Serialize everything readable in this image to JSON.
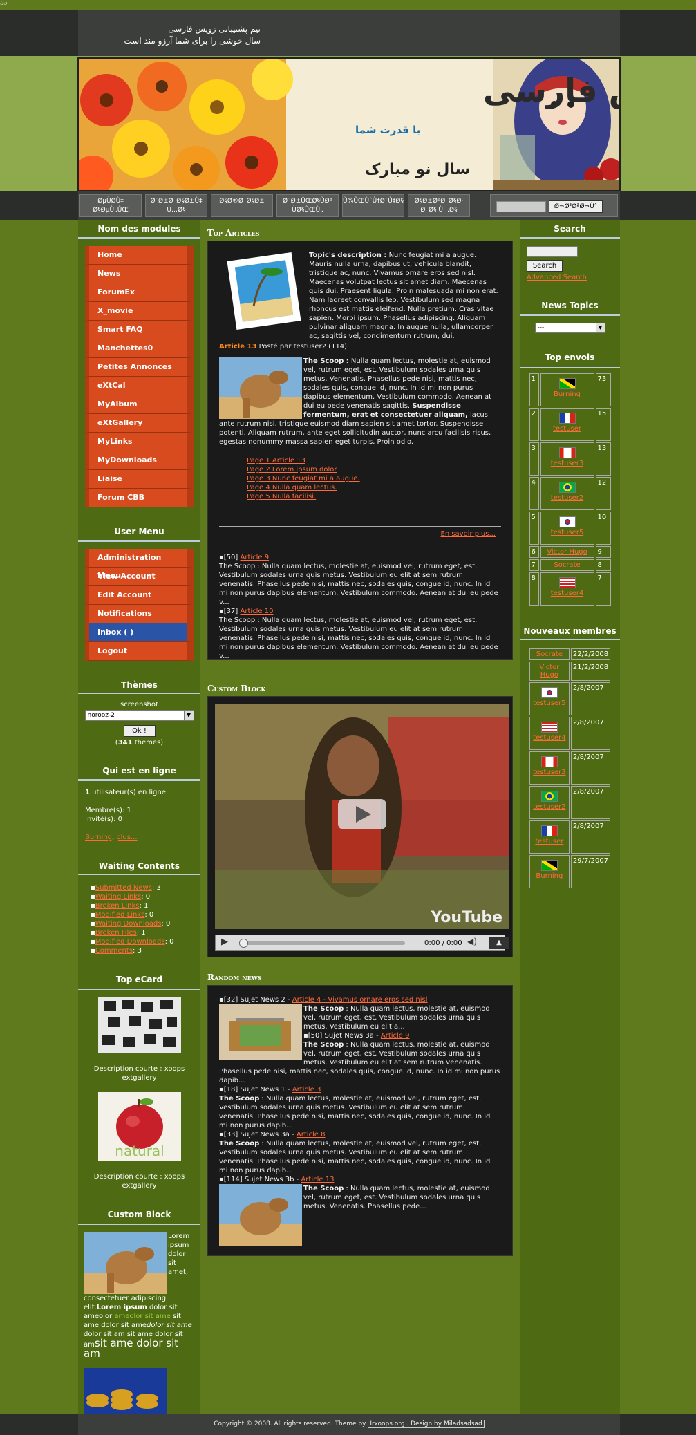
{
  "corner": "ﻯﻥ",
  "slogan": [
    "تیم پشتیبانی زوپس فارسی",
    "سال خوشی را برای شما آرزو مند است"
  ],
  "banner": {
    "title": "زوپس فارسی",
    "subtitle": "با قدرت شما",
    "greeting": "سال نو مبارک"
  },
  "nav": {
    "items": [
      "ØµÙØ­Ù‡ Ø§ØµÙ„ÛŒ",
      "Ø¯Ø±Ø¨Ø§Ø±Ù‡ Ù…Ø§",
      "Ø§Ø®Ø¨Ø§Ø±",
      "Ø¯Ø±ÛŒØ§ÙØª ÙØ§ÛŒÙ„",
      "Ù¾ÛŒÙˆÙ†Ø¯Ù‡Ø§",
      "Ø§Ø±ØªØ¨Ø§Ø· Ø¨Ø§ Ù…Ø§"
    ],
    "search_button": "Ø¬Ø³ØªØ¬Ùˆ"
  },
  "left": {
    "modules_title": "Nom des modules",
    "modules": [
      "Home",
      "News",
      "ForumEx",
      "X_movie",
      "Smart FAQ",
      "Manchettes0",
      "Petites Annonces",
      "eXtCal",
      "MyAlbum",
      "eXtGallery",
      "MyLinks",
      "MyDownloads",
      "Liaise",
      "Forum CBB"
    ],
    "user_title": "User Menu",
    "user_menu": [
      "Administration Menu",
      "View Account",
      "Edit Account",
      "Notifications",
      "Inbox ( )",
      "Logout"
    ],
    "themes_title": "Thèmes",
    "themes_screenshot": "screenshot",
    "themes_selected": "norooz-2",
    "themes_ok": "Ok !",
    "themes_count": "341",
    "themes_suffix": "themes)",
    "online_title": "Qui est en ligne",
    "online_count": "1",
    "online_text": "utilisateur(s) en ligne",
    "members": "Membre(s): 1",
    "guests": "Invité(s): 0",
    "online_user": "Burning",
    "online_more": "plus...",
    "waiting_title": "Waiting Contents",
    "waiting": [
      {
        "label": "Submitted News",
        "count": "3"
      },
      {
        "label": "Waiting Links",
        "count": "0"
      },
      {
        "label": "Broken Links",
        "count": "1"
      },
      {
        "label": "Modified Links",
        "count": "0"
      },
      {
        "label": "Waiting Downloads",
        "count": "0"
      },
      {
        "label": "Broken Files",
        "count": "1"
      },
      {
        "label": "Modified Downloads",
        "count": "0"
      },
      {
        "label": "Comments",
        "count": "3"
      }
    ],
    "ecard_title": "Top eCard",
    "ecard_desc1": "Description courte : xoops extgallery",
    "ecard_natural": "natural",
    "ecard_desc2": "Description courte : xoops extgallery",
    "custom_title": "Custom Block",
    "custom_text1": "Lorem ipsum dolor sit amet, consectetuer adipiscing elit.",
    "custom_bold": "Lorem ipsum",
    "custom_text2": "dolor sit ameolor",
    "custom_green": "ameolor sit ame",
    "custom_text3": "sit ame dolor sit ame",
    "custom_italic": "dolor sit ame",
    "custom_text4": "dolor sit am sit ame dolor sit am",
    "custom_big": "sit ame dolor sit am"
  },
  "center": {
    "top_title": "Top Articles",
    "topic_label": "Topic's description :",
    "topic_text": "Nunc feugiat mi a augue. Mauris nulla urna, dapibus ut, vehicula blandit, tristique ac, nunc. Vivamus ornare eros sed nisl. Maecenas volutpat lectus sit amet diam. Maecenas quis dui. Praesent ligula. Proin malesuada mi non erat. Nam laoreet convallis leo. Vestibulum sed magna rhoncus est mattis eleifend. Nulla pretium. Cras vitae sapien. Morbi ipsum. Phasellus adipiscing. Aliquam pulvinar aliquam magna. In augue nulla, ullamcorper ac, sagittis vel, condimentum rutrum, dui.",
    "article_label": "Article 13",
    "article_posted": "Posté par testuser2 (114)",
    "scoop_label": "The Scoop :",
    "scoop_text": "Nulla quam lectus, molestie at, euismod vel, rutrum eget, est. Vestibulum sodales urna quis metus. Venenatis. Phasellus pede nisi, mattis nec, sodales quis, congue id, nunc. In id mi non purus dapibus elementum. Vestibulum commodo. Aenean at dui eu pede venenatis sagittis.",
    "scoop_bold": "Suspendisse fermentum, erat et consectetuer aliquam,",
    "scoop_text2": "lacus ante rutrum nisi, tristique euismod diam sapien sit amet tortor. Suspendisse potenti. Aliquam rutrum, ante eget sollicitudin auctor, nunc arcu facilisis risus, egestas nonummy massa sapien eget turpis. Proin odio.",
    "pages": [
      "Page 1 Article 13",
      "Page 2 Lorem ipsum dolor",
      "Page 3 Nunc feugiat mi a augue.",
      "Page 4 Nulla quam lectus.",
      "Page 5 Nulla facilisi."
    ],
    "readmore": "En savoir plus...",
    "art9_prefix": "[50]",
    "art9_link": "Article 9",
    "art9_text": "The Scoop : Nulla quam lectus, molestie at, euismod vel, rutrum eget, est. Vestibulum sodales urna quis metus. Vestibulum eu elit at sem rutrum venenatis. Phasellus pede nisi, mattis nec, sodales quis, congue id, nunc. In id mi non purus dapibus elementum. Vestibulum commodo. Aenean at dui eu pede v...",
    "art10_prefix": "[37]",
    "art10_link": "Article 10",
    "art10_text": "The Scoop : Nulla quam lectus, molestie at, euismod vel, rutrum eget, est. Vestibulum sodales urna quis metus. Vestibulum eu elit at sem rutrum venenatis. Phasellus pede nisi, mattis nec, sodales quis, congue id, nunc. In id mi non purus dapibus elementum. Vestibulum commodo. Aenean at dui eu pede v...",
    "custom_title": "Custom Block",
    "video_time": "0:00 / 0:00",
    "video_brand": "YouTube",
    "random_title": "Random news",
    "random": [
      {
        "prefix": "[32] Sujet News 2 -",
        "link": "Article 4 - Vivamus ornare eros sed nisl",
        "text": "Nulla quam lectus, molestie at, euismod vel, rutrum eget, est. Vestibulum sodales urna quis metus. Vestibulum eu elit a..."
      },
      {
        "prefix": "[50] Sujet News 3a -",
        "link": "Article 9",
        "text": "Nulla quam lectus, molestie at, euismod vel, rutrum eget, est. Vestibulum sodales urna quis metus. Vestibulum eu elit at sem rutrum venenatis. Phasellus pede nisi, mattis nec, sodales quis, congue id, nunc. In id mi non purus dapib..."
      },
      {
        "prefix": "[18] Sujet News 1 -",
        "link": "Article 3",
        "text": "Nulla quam lectus, molestie at, euismod vel, rutrum eget, est. Vestibulum sodales urna quis metus. Vestibulum eu elit at sem rutrum venenatis. Phasellus pede nisi, mattis nec, sodales quis, congue id, nunc. In id mi non purus dapib..."
      },
      {
        "prefix": "[33] Sujet News 3a -",
        "link": "Article 8",
        "text": "Nulla quam lectus, molestie at, euismod vel, rutrum eget, est. Vestibulum sodales urna quis metus. Vestibulum eu elit at sem rutrum venenatis. Phasellus pede nisi, mattis nec, sodales quis, congue id, nunc. In id mi non purus dapib..."
      },
      {
        "prefix": "[114] Sujet News 3b -",
        "link": "Article 13",
        "text": "Nulla quam lectus, molestie at, euismod vel, rutrum eget, est. Vestibulum sodales urna quis metus. Venenatis. Phasellus pede..."
      }
    ]
  },
  "right": {
    "search_title": "Search",
    "search_button": "Search",
    "advanced": "Advanced Search",
    "topics_title": "News Topics",
    "topics_selected": "---",
    "top_title": "Top envois",
    "top": [
      {
        "rank": "1",
        "user": "Burning",
        "count": "73",
        "flag": "jamaica"
      },
      {
        "rank": "2",
        "user": "testuser",
        "count": "15",
        "flag": "france"
      },
      {
        "rank": "3",
        "user": "testuser3",
        "count": "13",
        "flag": "canada"
      },
      {
        "rank": "4",
        "user": "testuser2",
        "count": "12",
        "flag": "brazil"
      },
      {
        "rank": "5",
        "user": "testuser5",
        "count": "10",
        "flag": "korea"
      },
      {
        "rank": "6",
        "user": "Victor Hugo",
        "count": "9",
        "flag": ""
      },
      {
        "rank": "7",
        "user": "Socrate",
        "count": "8",
        "flag": ""
      },
      {
        "rank": "8",
        "user": "testuser4",
        "count": "7",
        "flag": "usa"
      }
    ],
    "new_title": "Nouveaux membres",
    "new_members": [
      {
        "user": "Socrate",
        "date": "22/2/2008",
        "flag": ""
      },
      {
        "user": "Victor Hugo",
        "date": "21/2/2008",
        "flag": ""
      },
      {
        "user": "testuser5",
        "date": "2/8/2007",
        "flag": "korea"
      },
      {
        "user": "testuser4",
        "date": "2/8/2007",
        "flag": "usa"
      },
      {
        "user": "testuser3",
        "date": "2/8/2007",
        "flag": "canada"
      },
      {
        "user": "testuser2",
        "date": "2/8/2007",
        "flag": "brazil"
      },
      {
        "user": "testuser",
        "date": "2/8/2007",
        "flag": "france"
      },
      {
        "user": "Burning",
        "date": "29/7/2007",
        "flag": "jamaica"
      }
    ]
  },
  "footer": {
    "copyright": "Copyright © 2008. All rights reserved. Theme by",
    "credit": "Irxoops.org . Design by Miladsadsad"
  }
}
